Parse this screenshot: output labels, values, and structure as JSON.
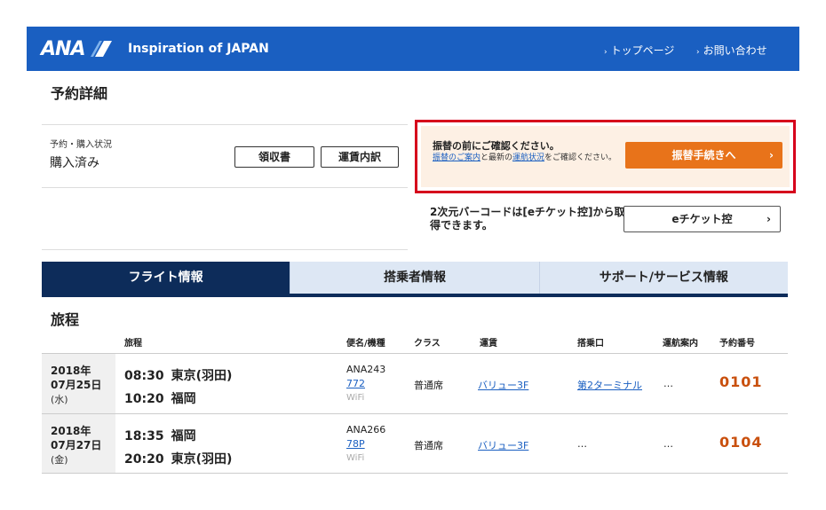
{
  "header": {
    "logo": "ANA",
    "tagline": "Inspiration of JAPAN",
    "links": [
      "トップページ",
      "お問い合わせ"
    ],
    "color": "#1a5fc1"
  },
  "page_title": "予約詳細",
  "status": {
    "label": "予約・購入状況",
    "value": "購入済み",
    "receipt_button": "領収書",
    "fare_detail_button": "運賃内訳"
  },
  "alert": {
    "title": "振替の前にご確認ください。",
    "desc_link1": "振替のご案内",
    "desc_mid": "と最新の",
    "desc_link2": "運航状況",
    "desc_end": "をご確認ください。",
    "button": "振替手続きへ",
    "border_color": "#d6001c",
    "button_color": "#e8731a"
  },
  "eticket": {
    "text": "2次元バーコードは[eチケット控]から取得できます。",
    "button": "eチケット控"
  },
  "tabs": [
    "フライト情報",
    "搭乗者情報",
    "サポート/サービス情報"
  ],
  "itinerary": {
    "title": "旅程",
    "columns": [
      "旅程",
      "便名/機種",
      "クラス",
      "運賃",
      "搭乗口",
      "運航案内",
      "予約番号"
    ],
    "rows": [
      {
        "year": "2018年",
        "date": "07月25日",
        "weekday": "(水)",
        "dep_time": "08:30",
        "dep_city": "東京(羽田)",
        "arr_time": "10:20",
        "arr_city": "福岡",
        "flight_no": "ANA243",
        "aircraft": "772",
        "wifi": "WiFi",
        "class": "普通席",
        "fare": "バリュー3F",
        "gate": "第2ターミナル",
        "info": "…",
        "res_no": "0101"
      },
      {
        "year": "2018年",
        "date": "07月27日",
        "weekday": "(金)",
        "dep_time": "18:35",
        "dep_city": "福岡",
        "arr_time": "20:20",
        "arr_city": "東京(羽田)",
        "flight_no": "ANA266",
        "aircraft": "78P",
        "wifi": "WiFi",
        "class": "普通席",
        "fare": "バリュー3F",
        "gate": "…",
        "info": "…",
        "res_no": "0104"
      }
    ]
  }
}
